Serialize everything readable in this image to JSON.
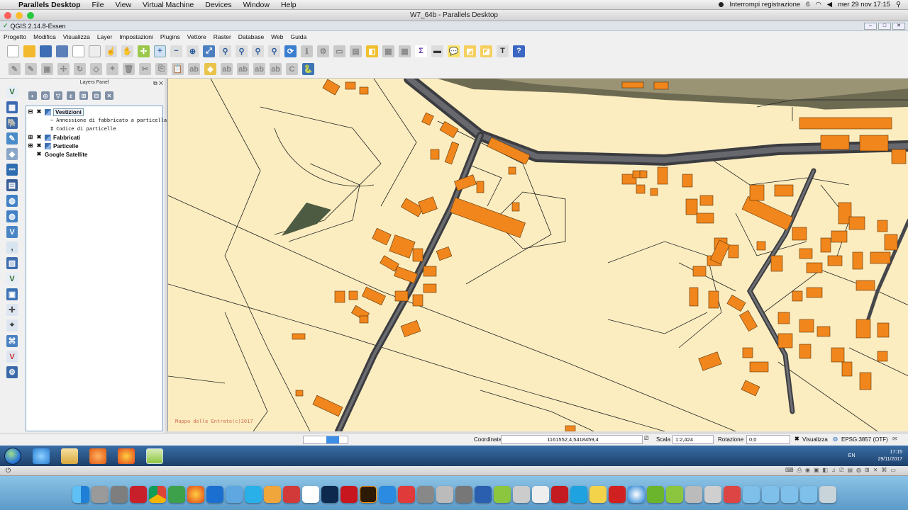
{
  "mac_menu": {
    "apple_glyph": "",
    "app": "Parallels Desktop",
    "items": [
      "File",
      "View",
      "Virtual Machine",
      "Devices",
      "Window",
      "Help"
    ],
    "recording": "Interrompi registrazione",
    "battery_count": "6",
    "datetime": "mer 29 nov  17:15"
  },
  "pd_window_title": "W7_64b - Parallels Desktop",
  "qgis": {
    "title": "QGIS 2.14.8-Essen",
    "menu": [
      "Progetto",
      "Modifica",
      "Visualizza",
      "Layer",
      "Impostazioni",
      "Plugins",
      "Vettore",
      "Raster",
      "Database",
      "Web",
      "Guida"
    ],
    "layers_panel": {
      "title": "Layers Panel",
      "rows": [
        {
          "check": "✖",
          "expander": "⊟",
          "name": "Vestizioni",
          "bold": true,
          "selected": true
        },
        {
          "name": "Annessione di fabbricato a particella",
          "mono": true
        },
        {
          "name": "Codice di particelle",
          "mono": true
        },
        {
          "check": "✖",
          "expander": "⊞",
          "name": "Fabbricati",
          "bold": true
        },
        {
          "check": "✖",
          "expander": "⊞",
          "name": "Particelle",
          "bold": true
        },
        {
          "check": "✖",
          "name": "Google Satellite",
          "bold": true
        }
      ]
    },
    "map_watermark": "Mappa delle Entrate(c)2017",
    "status": {
      "coord_label": "Coordinata",
      "coord_value": "1161552,4,5418459,4",
      "scale_label": "Scala",
      "scale_value": "1:2,424",
      "rotation_label": "Rotazione",
      "rotation_value": "0,0",
      "render_label": "Visualizza",
      "crs": "EPSG:3857 (OTF)"
    }
  },
  "taskbar": {
    "lang": "EN",
    "time": "17:15",
    "date": "29/11/2017"
  },
  "colors": {
    "building": "#f0861c",
    "parcel_bg": "#fcedc0",
    "road": "#4b4d52"
  }
}
